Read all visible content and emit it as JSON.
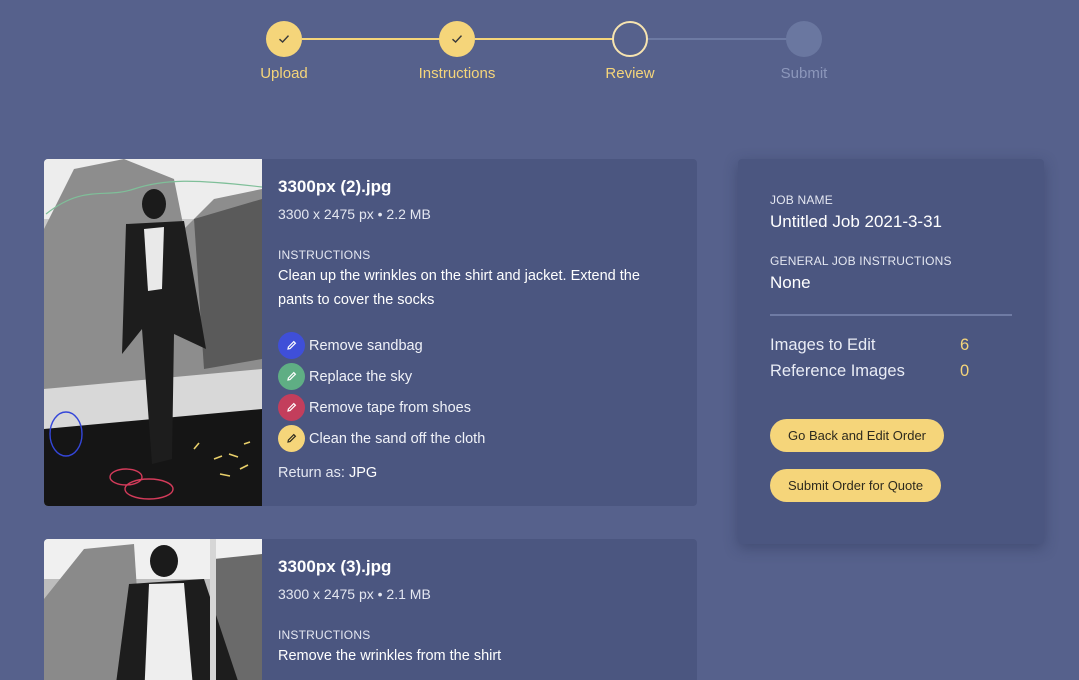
{
  "stepper": {
    "steps": [
      {
        "label": "Upload",
        "state": "done"
      },
      {
        "label": "Instructions",
        "state": "done"
      },
      {
        "label": "Review",
        "state": "current"
      },
      {
        "label": "Submit",
        "state": "todo"
      }
    ]
  },
  "images": [
    {
      "name": "3300px (2).jpg",
      "meta": "3300 x 2475 px • 2.2 MB",
      "instructions_label": "INSTRUCTIONS",
      "instructions": "Clean up the wrinkles on the shirt and jacket. Extend the pants to cover the socks",
      "markups": [
        {
          "label": "Remove sandbag",
          "color": "#3f4fd8"
        },
        {
          "label": "Replace the sky",
          "color": "#5fae84"
        },
        {
          "label": "Remove tape from shoes",
          "color": "#c33e5c"
        },
        {
          "label": "Clean the sand off the cloth",
          "color": "#f5d57a"
        }
      ],
      "return_as_label": "Return as:",
      "return_as_value": "JPG"
    },
    {
      "name": "3300px (3).jpg",
      "meta": "3300 x 2475 px • 2.1 MB",
      "instructions_label": "INSTRUCTIONS",
      "instructions": "Remove the wrinkles from the shirt"
    }
  ],
  "summary": {
    "job_name_label": "JOB NAME",
    "job_name": "Untitled Job 2021-3-31",
    "general_label": "GENERAL JOB INSTRUCTIONS",
    "general_value": "None",
    "images_to_edit_label": "Images to Edit",
    "images_to_edit": "6",
    "reference_label": "Reference Images",
    "reference": "0",
    "edit_button": "Go Back and Edit Order",
    "submit_button": "Submit Order for Quote"
  },
  "colors": {
    "background": "#56618c",
    "panel": "#4b5680",
    "accent": "#f5d57a"
  }
}
